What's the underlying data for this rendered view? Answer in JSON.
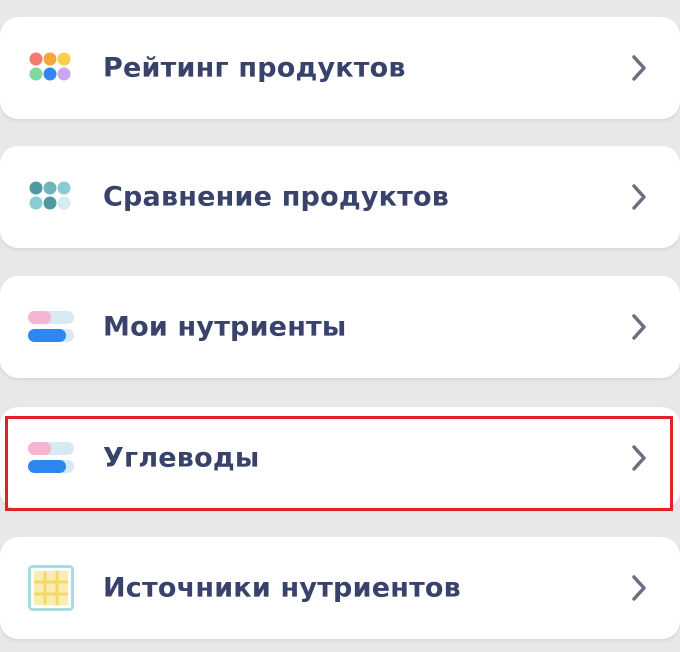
{
  "menu": {
    "items": [
      {
        "label": "Рейтинг продуктов",
        "icon": "colored-dots-grid-icon"
      },
      {
        "label": "Сравнение продуктов",
        "icon": "teal-dots-grid-icon"
      },
      {
        "label": "Мои нутриенты",
        "icon": "nutrient-bars-icon"
      },
      {
        "label": "Углеводы",
        "icon": "nutrient-bars-icon",
        "highlighted": true
      },
      {
        "label": "Источники нутриентов",
        "icon": "table-grid-icon"
      }
    ]
  },
  "colors": {
    "background": "#e8e8ea",
    "card": "#ffffff",
    "text": "#38426a",
    "chevron": "#6b7080",
    "highlight": "#e3202a"
  }
}
